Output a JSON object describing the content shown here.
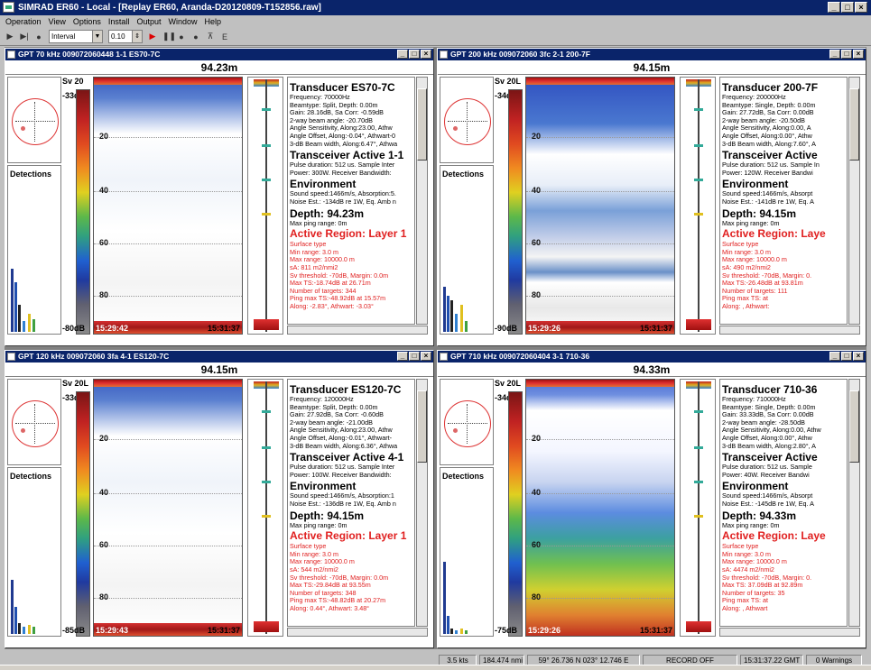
{
  "app": {
    "title": "SIMRAD ER60 - Local - [Replay ER60, Aranda-D20120809-T152856.raw]",
    "window_buttons": [
      "_",
      "□",
      "×"
    ]
  },
  "menu": [
    "Operation",
    "View",
    "Options",
    "Install",
    "Output",
    "Window",
    "Help"
  ],
  "toolbar": {
    "mode_value": "Interval",
    "interval_value": "0.10"
  },
  "panels": [
    {
      "title": "GPT  70 kHz 009072060448 1-1 ES70-7C",
      "depth": "94.23m",
      "sv": "Sv 20",
      "scale_top": "-33dB",
      "scale_bottom": "-80dB",
      "detections": "Detections",
      "depths": [
        "20",
        "40",
        "60",
        "80"
      ],
      "time_start": "15:29:42",
      "time_end": "15:31:37",
      "transducer": "Transducer ES70-7C",
      "t_lines": [
        "Frequency: 70000Hz",
        "Beamtype: Split, Depth: 0.00m",
        "Gain: 28.16dB, Sa Corr: -0.59dB",
        "2-way beam angle: -20.70dB",
        "Angle Sensitivity, Along:23.00, Athw",
        "Angle Offset, Along:-0.04°, Athwart-0",
        "3-dB Beam width, Along:6.47°, Athwa"
      ],
      "transceiver": "Transceiver Active  1-1",
      "tr_lines": [
        "Pulse duration: 512 us. Sample Inter",
        "Power: 300W. Receiver Bandwidth:"
      ],
      "environment": "Environment",
      "env_lines": [
        "Sound speed:1466m/s, Absorption:5.",
        "Noise Est.: -134dB re 1W, Eq. Amb n"
      ],
      "depth_hdr": "Depth: 94.23m",
      "max_ping": "Max ping range: 0m",
      "active_region": "Active Region: Layer 1",
      "ar_lines": [
        "Surface type",
        "Min range: 3.0 m",
        "Max range: 10000.0 m",
        "sA: 811 m2/nmi2",
        "Sv threshold: -70dB, Margin: 0.0m",
        "Max TS:-18.74dB at 26.71m",
        "Number of targets:  344",
        "Ping max TS:-48.92dB at 15.57m",
        "Along: -2.83°, Athwart: -3.03°"
      ]
    },
    {
      "title": "GPT 200 kHz 009072060 3fc 2-1 200-7F",
      "depth": "94.15m",
      "sv": "Sv 20L",
      "scale_top": "-34dB",
      "scale_bottom": "-90dB",
      "detections": "Detections",
      "depths": [
        "20",
        "40",
        "60",
        "80"
      ],
      "time_start": "15:29:26",
      "time_end": "15:31:37",
      "transducer": "Transducer 200-7F",
      "t_lines": [
        "Frequency: 200000Hz",
        "Beamtype: Single, Depth: 0.00m",
        "Gain: 27.72dB, Sa Corr: 0.00dB",
        "2-way beam angle: -20.50dB",
        "Angle Sensitivity, Along:0.00, A",
        "Angle Offset, Along:0.00°, Athw",
        "3-dB Beam width, Along:7.60°, A"
      ],
      "transceiver": "Transceiver Active",
      "tr_lines": [
        "Pulse duration: 512 us. Sample In",
        "Power: 120W. Receiver Bandwi"
      ],
      "environment": "Environment",
      "env_lines": [
        "Sound speed:1466m/s, Absorpt",
        "Noise Est.: -141dB re 1W, Eq. A"
      ],
      "depth_hdr": "Depth: 94.15m",
      "max_ping": "Max ping range: 0m",
      "active_region": "Active Region: Laye",
      "ar_lines": [
        "Surface type",
        "Min range: 3.0 m",
        "Max range: 10000.0 m",
        "sA: 490 m2/nmi2",
        "Sv threshold: -70dB, Margin: 0.",
        "Max TS:-26.48dB at 93.81m",
        "Number of targets:  111",
        "Ping max TS:        at",
        "Along:        , Athwart:"
      ]
    },
    {
      "title": "GPT 120 kHz 009072060 3fa 4-1 ES120-7C",
      "depth": "94.15m",
      "sv": "Sv 20L",
      "scale_top": "-33dB",
      "scale_bottom": "-85dB",
      "detections": "Detections",
      "depths": [
        "20",
        "40",
        "60",
        "80"
      ],
      "time_start": "15:29:43",
      "time_end": "15:31:37",
      "transducer": "Transducer ES120-7C",
      "t_lines": [
        "Frequency: 120000Hz",
        "Beamtype: Split, Depth: 0.00m",
        "Gain: 27.92dB, Sa Corr: -0.60dB",
        "2-way beam angle: -21.00dB",
        "Angle Sensitivity, Along:23.00, Athw",
        "Angle Offset, Along:-0.01°, Athwart-",
        "3-dB Beam width, Along:6.36°, Athwa"
      ],
      "transceiver": "Transceiver Active  4-1",
      "tr_lines": [
        "Pulse duration: 512 us. Sample Inter",
        "Power: 100W. Receiver Bandwidth:"
      ],
      "environment": "Environment",
      "env_lines": [
        "Sound speed:1466m/s, Absorption:1",
        "Noise Est.: -136dB re 1W, Eq. Amb n"
      ],
      "depth_hdr": "Depth: 94.15m",
      "max_ping": "Max ping range: 0m",
      "active_region": "Active Region: Layer 1",
      "ar_lines": [
        "Surface type",
        "Min range: 3.0 m",
        "Max range: 10000.0 m",
        "sA: 544 m2/nmi2",
        "Sv threshold: -70dB, Margin: 0.0m",
        "Max TS:-29.84dB at 93.55m",
        "Number of targets:  348",
        "Ping max TS:-48.82dB at 20.27m",
        "Along: 0.44°, Athwart: 3.48°"
      ]
    },
    {
      "title": "GPT 710 kHz 009072060404 3-1 710-36",
      "depth": "94.33m",
      "sv": "Sv 20L",
      "scale_top": "-34dB",
      "scale_bottom": "-75dB",
      "detections": "Detections",
      "depths": [
        "20",
        "40",
        "60",
        "80"
      ],
      "time_start": "15:29:26",
      "time_end": "15:31:37",
      "transducer": "Transducer 710-36",
      "t_lines": [
        "Frequency: 710000Hz",
        "Beamtype: Single, Depth: 0.00m",
        "Gain: 33.33dB, Sa Corr: 0.00dB",
        "2-way beam angle: -28.50dB",
        "Angle Sensitivity, Along:0.00, Athw",
        "Angle Offset, Along:0.00°, Athw",
        "3-dB Beam width, Along:2.80°, A"
      ],
      "transceiver": "Transceiver Active",
      "tr_lines": [
        "Pulse duration: 512 us. Sample",
        "Power: 40W. Receiver Bandwi"
      ],
      "environment": "Environment",
      "env_lines": [
        "Sound speed:1466m/s, Absorpt",
        "Noise Est.: -145dB re 1W, Eq. A"
      ],
      "depth_hdr": "Depth: 94.33m",
      "max_ping": "Max ping range: 0m",
      "active_region": "Active Region: Laye",
      "ar_lines": [
        "Surface type",
        "Min range: 3.0 m",
        "Max range: 10000.0 m",
        "sA: 4474 m2/nmi2",
        "Sv threshold: -70dB, Margin: 0.",
        "Max TS: 37.09dB at 92.89m",
        "Number of targets:  35",
        "Ping max TS:     at",
        "Along:        , Athwart"
      ]
    }
  ],
  "status": [
    "3.5 kts",
    "184.474 nmi",
    "59° 26.736 N  023° 12.746 E",
    "RECORD OFF",
    "15:31:37.22 GMT",
    "0 Warnings"
  ],
  "colors": {
    "title_blue": "#0a246a",
    "region_red": "#e02020"
  }
}
